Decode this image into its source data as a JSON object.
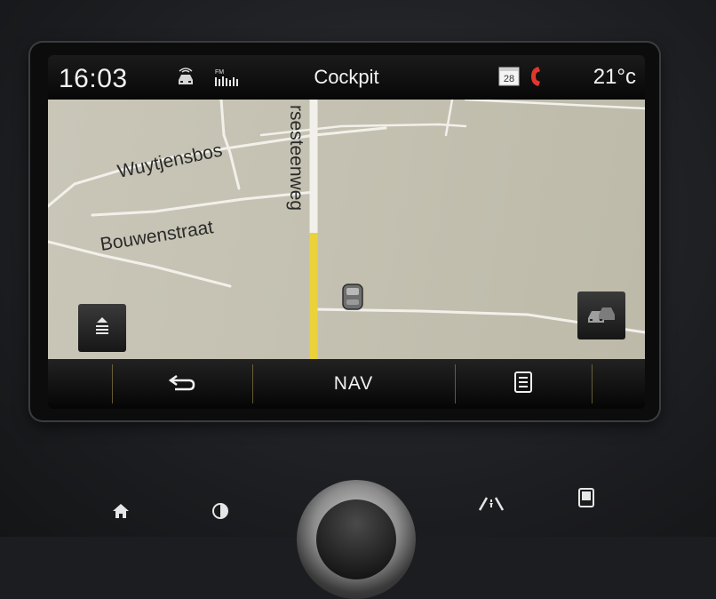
{
  "status_bar": {
    "clock": "16:03",
    "title": "Cockpit",
    "calendar_day": "28",
    "temperature": "21°c",
    "icons": [
      "driver-assist-icon",
      "fm-radio-icon",
      "calendar-icon",
      "phone-icon"
    ]
  },
  "map": {
    "streets": {
      "wuytjensbos": "Wuytjensbos",
      "bouwenstraat": "Bouwenstraat",
      "steenweg": "rsesteenweg"
    },
    "colors": {
      "background": "#c7c4b5",
      "road": "#f2f0ea",
      "highlighted_road": "#ead23a"
    },
    "left_button_icon": "menu-list-icon",
    "right_button_icon": "traffic-view-icon",
    "vehicle_icon": "car-position-icon"
  },
  "bottom_bar": {
    "back_icon": "back-arrow-icon",
    "nav_label": "NAV",
    "menu_icon": "list-menu-icon",
    "accent_color": "#8a7a45"
  },
  "hardware_buttons": [
    "home-icon",
    "brightness-icon",
    "driving-mode-icon",
    "phone-screen-icon"
  ]
}
